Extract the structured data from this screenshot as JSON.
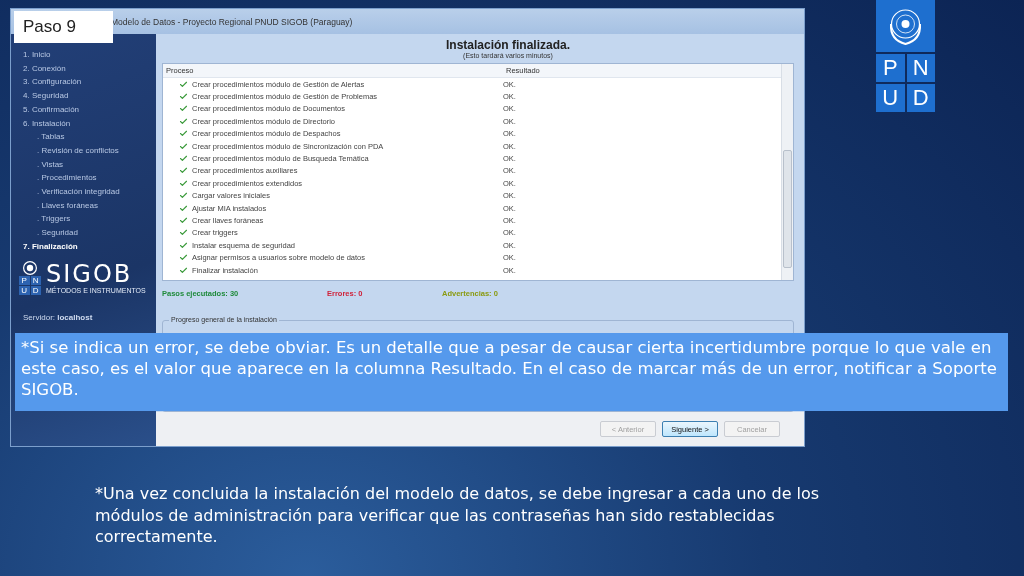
{
  "step_label": "Paso 9",
  "window": {
    "title": "Modelo de Datos - Proyecto Regional PNUD SIGOB (Paraguay)"
  },
  "sidebar": {
    "items": [
      {
        "label": "1. Inicio",
        "selected": false
      },
      {
        "label": "2. Conexión",
        "selected": false
      },
      {
        "label": "3. Configuración",
        "selected": false
      },
      {
        "label": "4. Seguridad",
        "selected": false
      },
      {
        "label": "5. Confirmación",
        "selected": false
      },
      {
        "label": "6. Instalación",
        "selected": false,
        "children": [
          {
            "label": ". Tablas",
            "selected": false
          },
          {
            "label": ". Revisión de conflictos",
            "selected": false
          },
          {
            "label": ". Vistas",
            "selected": false
          },
          {
            "label": ". Procedimientos",
            "selected": false
          },
          {
            "label": ". Verificación integridad",
            "selected": false
          },
          {
            "label": ". Llaves foráneas",
            "selected": false
          },
          {
            "label": ". Triggers",
            "selected": false
          },
          {
            "label": ". Seguridad",
            "selected": false
          }
        ]
      },
      {
        "label": "7. Finalización",
        "selected": true
      }
    ],
    "brand": {
      "name": "SIGOB",
      "tagline": "MÉTODOS E INSTRUMENTOS",
      "letters": [
        "P",
        "N",
        "U",
        "D"
      ]
    },
    "server": "Servidor: **localhost**"
  },
  "main": {
    "title": "Instalación finalizada.",
    "subtitle": "(Esto tardará varios minutos)",
    "table": {
      "columns": [
        "Proceso",
        "Resultado"
      ],
      "rows": [
        {
          "process": "Crear procedimientos módulo de Gestión de Alertas",
          "result": "OK."
        },
        {
          "process": "Crear procedimientos módulo de Gestión de Problemas",
          "result": "OK."
        },
        {
          "process": "Crear procedimientos módulo de Documentos",
          "result": "OK."
        },
        {
          "process": "Crear procedimientos módulo de Directorio",
          "result": "OK."
        },
        {
          "process": "Crear procedimientos módulo de Despachos",
          "result": "OK."
        },
        {
          "process": "Crear procedimientos módulo de Sincronización con PDA",
          "result": "OK."
        },
        {
          "process": "Crear procedimientos módulo de Busqueda Temática",
          "result": "OK."
        },
        {
          "process": "Crear procedimientos auxiliares",
          "result": "OK."
        },
        {
          "process": "Crear procedimientos extendidos",
          "result": "OK."
        },
        {
          "process": "Cargar valores iniciales",
          "result": "OK."
        },
        {
          "process": "Ajustar MIA instalados",
          "result": "OK."
        },
        {
          "process": "Crear llaves foráneas",
          "result": "OK."
        },
        {
          "process": "Crear triggers",
          "result": "OK."
        },
        {
          "process": "Instalar esquema de seguridad",
          "result": "OK."
        },
        {
          "process": "Asignar permisos a usuarios sobre modelo de datos",
          "result": "OK."
        },
        {
          "process": "Finalizar instalación",
          "result": "OK."
        }
      ]
    },
    "stats": [
      {
        "text": "Pasos ejecutados: 30",
        "color": "#1f8a3a"
      },
      {
        "text": "Errores: 0",
        "color": "#d0223a"
      },
      {
        "text": "Advertencias: 0",
        "color": "#8a9a10"
      }
    ],
    "progress_group": "Progreso general de la instalación",
    "buttons": [
      {
        "label": "< Anterior",
        "disabled": true
      },
      {
        "label": "Siguiente >",
        "disabled": false
      },
      {
        "label": "Cancelar",
        "disabled": true
      }
    ]
  },
  "callout": "*Si se indica un error, se debe obviar. Es un detalle que a pesar de causar cierta incertidumbre porque lo que vale en este caso, es el valor que aparece en la columna Resultado. En el caso de marcar más de un error, notificar a Soporte SIGOB.",
  "note": "*Una vez concluida la instalación del modelo de datos, se debe ingresar a cada uno de los módulos de administración para verificar que las contraseñas han sido restablecidas correctamente.",
  "logo": {
    "letters": [
      "P",
      "N",
      "U",
      "D"
    ]
  }
}
